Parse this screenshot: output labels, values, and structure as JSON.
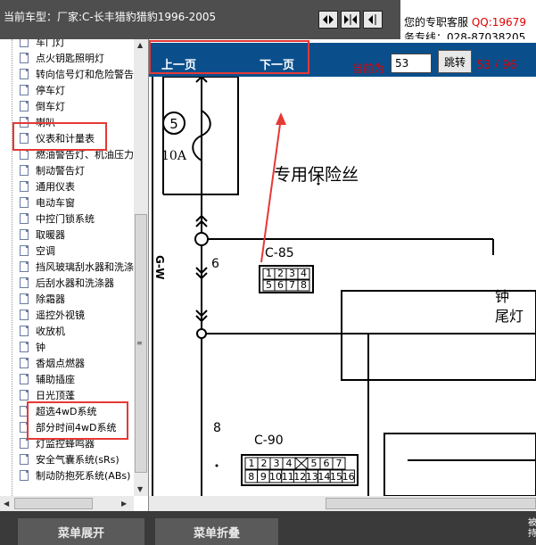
{
  "header": {
    "title": "当前车型：厂家:C-长丰猎豹猎豹1996-2005",
    "service_line1": "您的专职客服",
    "service_qq": "QQ:19679",
    "service_line2": "务专线：028-87038205"
  },
  "tree": {
    "items": [
      "车门灯",
      "点火钥匙照明灯",
      "转向信号灯和危险警告",
      "停车灯",
      "倒车灯",
      "喇叭",
      "仪表和计量表",
      "燃油警告灯、机油压力",
      "制动警告灯",
      "通用仪表",
      "电动车窗",
      "中控门锁系统",
      "取暖器",
      "空调",
      "挡风玻璃刮水器和洗涤",
      "后刮水器和洗涤器",
      "除霜器",
      "遥控外视镜",
      "收放机",
      "钟",
      "香烟点燃器",
      "辅助插座",
      "日光顶蓬",
      "超选4wD系统",
      "部分时间4wD系统",
      "灯监控蜂鸣器",
      "安全气囊系统(sRs)",
      "制动防抱死系统(ABs)"
    ]
  },
  "toolbar": {
    "prev": "上一页",
    "next": "下一页",
    "current_label": "当前为",
    "page_value": "53",
    "jump": "跳转",
    "pages": "53 / 96"
  },
  "diagram": {
    "fuse_number": "5",
    "fuse_rating": "10A",
    "fuse_label": "专用保险丝",
    "wire_color": "G-W",
    "wire_num_1": "6",
    "wire_num_2": "8",
    "connector_1": "C-85",
    "connector_2": "C-90",
    "c85_top": [
      "1",
      "2",
      "3",
      "4"
    ],
    "c85_bottom": [
      "5",
      "6",
      "7",
      "8"
    ],
    "c90_top": [
      "1",
      "2",
      "3",
      "4",
      "",
      "5",
      "6",
      "7"
    ],
    "c90_bottom": [
      "8",
      "9",
      "10",
      "11",
      "12",
      "13",
      "14",
      "15",
      "16"
    ],
    "right_label_1": "钟",
    "right_label_2": "尾灯"
  },
  "bottom": {
    "expand": "菜单展开",
    "collapse": "菜单折叠",
    "side_text": "被\n持"
  }
}
